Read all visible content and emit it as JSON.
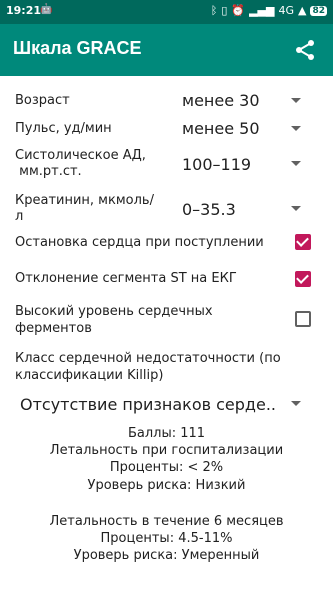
{
  "status": {
    "time": "19:21",
    "network": "4G",
    "battery": "82"
  },
  "toolbar": {
    "title": "Шкала GRACE"
  },
  "fields": {
    "age": {
      "label": "Возраст",
      "value": "менее 30"
    },
    "pulse": {
      "label": "Пульс, уд/мин",
      "value": "менее 50"
    },
    "bp": {
      "label_line1": "Систолическое АД,",
      "label_line2": " мм.рт.ст.",
      "value": "100–119"
    },
    "creat": {
      "label_line1": "Креатинин, мкмоль/",
      "label_line2": "л",
      "value": "0–35.3"
    }
  },
  "checks": {
    "arrest": {
      "label": "Остановка сердца при поступлении",
      "checked": true
    },
    "st": {
      "label": "Отклонение сегмента ST на ЕКГ",
      "checked": true
    },
    "enzymes": {
      "label_line1": "Высокий уровень сердечных",
      "label_line2": "ферментов",
      "checked": false
    }
  },
  "killip": {
    "label_line1": "Класс сердечной недостаточности (по",
    "label_line2": "классификации Killip)",
    "value": "Отсутствие признаков серде.."
  },
  "results": {
    "score": "Баллы: 111",
    "hosp_title": "Летальность при госпитализации",
    "hosp_percent": "Проценты:  < 2%",
    "hosp_risk": "Уроверь риска: Низкий",
    "six_title": "Летальность в течение 6 месяцев",
    "six_percent": "Проценты:  4.5-11%",
    "six_risk": "Уроверь риска: Умеренный"
  },
  "colors": {
    "statusbar": "#00695c",
    "toolbar": "#00897b",
    "checkbox": "#c2185b"
  }
}
